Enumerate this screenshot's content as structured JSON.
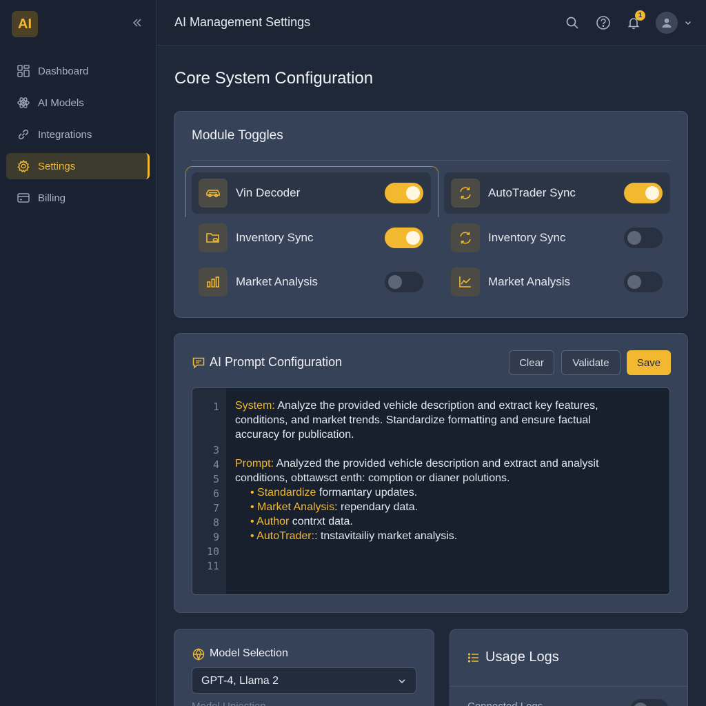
{
  "app": {
    "logo_text": "AI"
  },
  "sidebar": {
    "items": [
      {
        "label": "Dashboard"
      },
      {
        "label": "AI Models"
      },
      {
        "label": "Integrations"
      },
      {
        "label": "Settings",
        "active": true
      },
      {
        "label": "Billing"
      }
    ]
  },
  "header": {
    "title": "AI Management Settings",
    "notifications": "1"
  },
  "main": {
    "page_title": "Core System Configuration",
    "modules": {
      "title": "Module Toggles",
      "items": [
        {
          "label": "Vin Decoder",
          "icon": "car-icon",
          "on": true
        },
        {
          "label": "AutoTrader Sync",
          "icon": "refresh-icon",
          "on": true
        },
        {
          "label": "Inventory Sync",
          "icon": "folder-car-icon",
          "on": true
        },
        {
          "label": "Inventory Sync",
          "icon": "refresh-icon",
          "on": false
        },
        {
          "label": "Market Analysis",
          "icon": "bar-chart-icon",
          "on": false
        },
        {
          "label": "Market Analysis",
          "icon": "line-chart-icon",
          "on": false
        }
      ]
    },
    "prompt": {
      "title": "AI Prompt Configuration",
      "clear_label": "Clear",
      "validate_label": "Validate",
      "save_label": "Save",
      "line_numbers": [
        "1",
        "3",
        "4",
        "5",
        "6",
        "7",
        "8",
        "9",
        "10",
        "11"
      ],
      "system_key": "System:",
      "system_text_1": " Analyze the provided vehicle description and extract key features,",
      "system_text_2": "conditions, and market trends. Standardize formatting and ensure factual",
      "system_text_3": "accuracy for publication.",
      "prompt_key": "Prompt:",
      "prompt_text_1": " Analyzed the provided vehicle description and extract and analysit",
      "prompt_text_2": "conditions, obttawsct enth: comption or dianer polutions.",
      "bullets": [
        {
          "key": "Standardize",
          "text": " formantary updates."
        },
        {
          "key": "Market Analysis",
          "text": ": rependary data."
        },
        {
          "key": "Author",
          "text": " contrxt data."
        },
        {
          "key": "AutoTrader:",
          "text": ": tnstavitailiy market analysis."
        }
      ]
    },
    "model_selection": {
      "title": "Model Selection",
      "selected": "GPT-4, Llama 2",
      "sub_label": "Model Uniestion"
    },
    "usage_logs": {
      "title": "Usage Logs",
      "row_label": "Connected Logs"
    }
  },
  "colors": {
    "accent": "#f2b930",
    "background": "#1f2838",
    "card": "#364257"
  }
}
